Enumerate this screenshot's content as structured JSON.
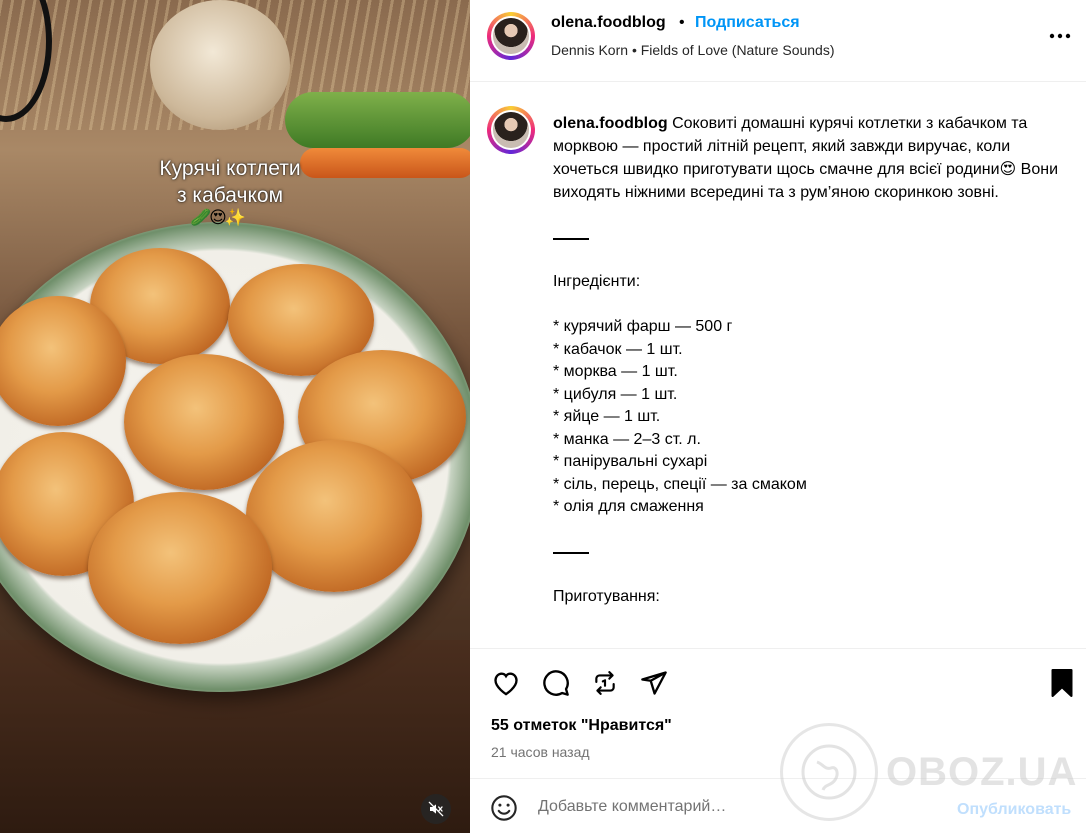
{
  "media": {
    "overlay_line1": "Курячі котлети",
    "overlay_line2": "з кабачком",
    "overlay_emoji": "🥒😍✨",
    "mute_icon": "speaker-muted-icon"
  },
  "header": {
    "username": "olena.foodblog",
    "separator": "•",
    "follow_label": "Подписаться",
    "audio_artist": "Dennis Korn",
    "audio_separator": "•",
    "audio_track": "Fields of Love (Nature Sounds)",
    "more_icon": "more-horizontal-icon"
  },
  "caption": {
    "username": "olena.foodblog",
    "intro": " Соковиті домашні курячі котлетки з кабачком та морквою — простий літній рецепт, який завжди виручає, коли хочеться швидко приготувати щось смачне для всієї родини",
    "intro_emoji": "😍",
    "intro_end": "Вони виходять ніжними всередині та з рум’яною скоринкою зовні.",
    "ingredients_title": "Інгредієнти:",
    "ingredients": [
      "* курячий фарш — 500 г",
      "* кабачок — 1 шт.",
      "* морква — 1 шт.",
      "* цибуля — 1 шт.",
      "* яйце — 1 шт.",
      "* манка — 2–3 ст. л.",
      "* панірувальні сухарі",
      "* сіль, перець, спеції — за смаком",
      "* олія для смаження"
    ],
    "prep_title": "Приготування:"
  },
  "actions": {
    "icons": [
      "heart-icon",
      "comment-icon",
      "repost-icon",
      "share-icon",
      "bookmark-icon"
    ],
    "likes": "55 отметок \"Нравится\"",
    "time": "21 часов назад"
  },
  "comment": {
    "placeholder": "Добавьте комментарий…",
    "publish_label": "Опубликовать",
    "emoji_icon": "emoji-smile-icon"
  },
  "watermark": {
    "text": "OBOZ.UA"
  },
  "colors": {
    "link_blue": "#0095f6",
    "publish_disabled": "#c0dffd",
    "muted_text": "#737373",
    "divider": "#efefef"
  }
}
